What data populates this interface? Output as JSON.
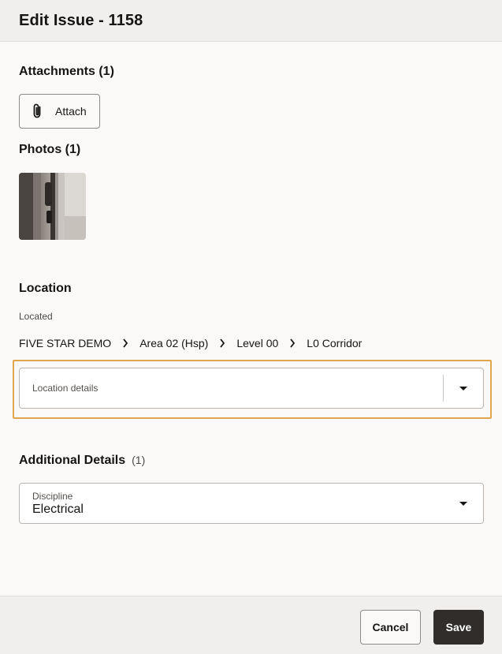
{
  "header": {
    "title": "Edit Issue - 1158"
  },
  "attachments": {
    "title": "Attachments (1)",
    "attach_label": "Attach"
  },
  "photos": {
    "title": "Photos (1)"
  },
  "location": {
    "title": "Location",
    "located_label": "Located",
    "path": [
      "FIVE STAR DEMO",
      "Area 02 (Hsp)",
      "Level 00",
      "L0 Corridor"
    ],
    "details_placeholder": "Location details"
  },
  "additional": {
    "title": "Additional Details",
    "count": "(1)",
    "discipline_label": "Discipline",
    "discipline_value": "Electrical"
  },
  "footer": {
    "cancel_label": "Cancel",
    "save_label": "Save"
  },
  "colors": {
    "highlight": "#e0a64f",
    "primary_button": "#312d2a",
    "header_bg": "#f1efed"
  }
}
